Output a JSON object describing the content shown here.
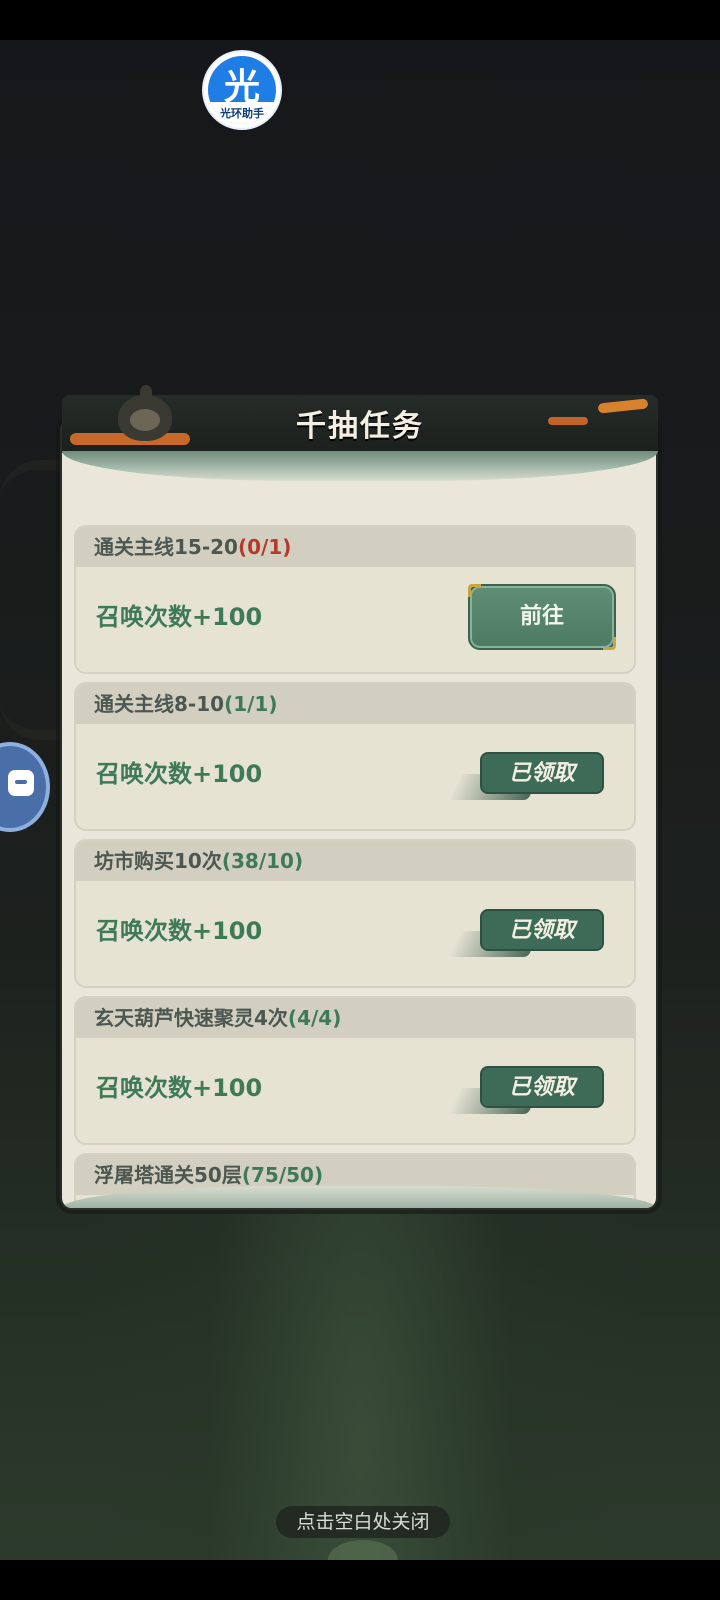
{
  "app_badge": {
    "char": "光",
    "label": "光环助手"
  },
  "panel": {
    "title": "千抽任务"
  },
  "tasks": [
    {
      "name": "通关主线15-20",
      "progress": "(0/1)",
      "progress_state": "incomplete",
      "reward": "召唤次数+100",
      "action": "前往"
    },
    {
      "name": "通关主线8-10",
      "progress": "(1/1)",
      "progress_state": "complete",
      "reward": "召唤次数+100",
      "action": "已领取"
    },
    {
      "name": "坊市购买10次",
      "progress": "(38/10)",
      "progress_state": "complete",
      "reward": "召唤次数+100",
      "action": "已领取"
    },
    {
      "name": "玄天葫芦快速聚灵4次",
      "progress": "(4/4)",
      "progress_state": "complete",
      "reward": "召唤次数+100",
      "action": "已领取"
    },
    {
      "name": "浮屠塔通关50层",
      "progress": "(75/50)",
      "progress_state": "complete"
    }
  ],
  "close_hint": "点击空白处关闭",
  "colors": {
    "accent_green": "#3f7a57",
    "progress_red": "#b53a2c",
    "button_green": "#5f8d75"
  }
}
